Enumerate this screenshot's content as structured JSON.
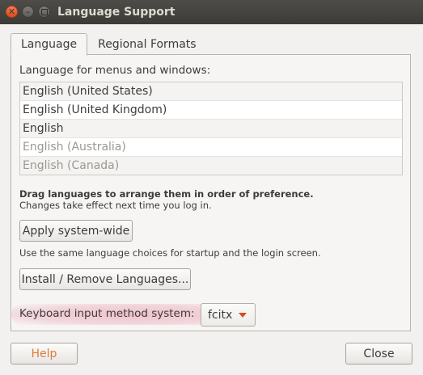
{
  "window": {
    "title": "Language Support"
  },
  "tabs": [
    {
      "label": "Language"
    },
    {
      "label": "Regional Formats"
    }
  ],
  "language_tab": {
    "list_label": "Language for menus and windows:",
    "languages": [
      "English (United States)",
      "English (United Kingdom)",
      "English",
      "English (Australia)",
      "English (Canada)"
    ],
    "drag_note": "Drag languages to arrange them in order of preference.",
    "changes_note": "Changes take effect next time you log in.",
    "apply_button": "Apply system-wide",
    "apply_note": "Use the same language choices for startup and the login screen.",
    "install_button": "Install / Remove Languages...",
    "input_method_label": "Keyboard input method system:",
    "input_method_value": "fcitx"
  },
  "footer": {
    "help_button": "Help",
    "close_button": "Close"
  },
  "colors": {
    "titlebar": "#3c3b37",
    "close_button": "#df4a16",
    "accent": "#df4a16",
    "help_text": "#e07a3a",
    "highlight": "#e26383"
  },
  "icons": [
    "close-icon",
    "minimize-icon",
    "maximize-icon",
    "dropdown-arrow-icon"
  ]
}
